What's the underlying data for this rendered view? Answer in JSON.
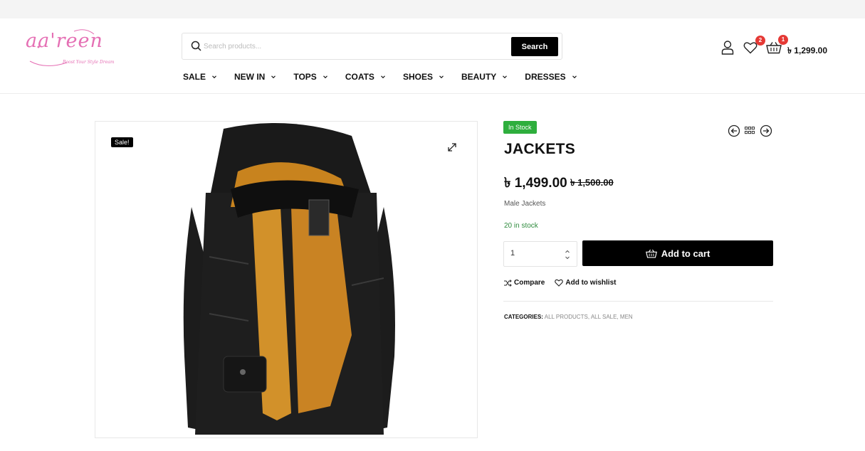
{
  "brand": {
    "logo_text": "aa'reen",
    "tagline": "Boost Your Style Dream",
    "color": "#e56fb4"
  },
  "search": {
    "placeholder": "Search products...",
    "button_label": "Search"
  },
  "nav": {
    "items": [
      {
        "label": "SALE"
      },
      {
        "label": "NEW IN"
      },
      {
        "label": "TOPS"
      },
      {
        "label": "COATS"
      },
      {
        "label": "SHOES"
      },
      {
        "label": "BEAUTY"
      },
      {
        "label": "DRESSES"
      }
    ]
  },
  "header_icons": {
    "account_icon": "user-icon",
    "wishlist_icon": "heart-icon",
    "wishlist_count": "2",
    "cart_icon": "basket-icon",
    "cart_count": "1",
    "cart_total": "৳ 1,299.00",
    "badge_color": "#e53935"
  },
  "gallery": {
    "sale_badge": "Sale!",
    "expand_icon": "expand-icon",
    "image_name": "black-hooded-jacket-with-fur-lining"
  },
  "product": {
    "stock_badge": "In Stock",
    "stock_badge_color": "#2eae3d",
    "title": "JACKETS",
    "price": "৳ 1,499.00",
    "old_price": "৳ 1,500.00",
    "short_description": "Male Jackets",
    "stock_text": "20 in stock",
    "quantity": "1",
    "add_to_cart_label": "Add to cart",
    "compare_label": "Compare",
    "wishlist_label": "Add to wishlist",
    "categories_label": "CATEGORIES:",
    "categories": [
      "ALL PRODUCTS",
      "ALL SALE",
      "MEN"
    ]
  }
}
